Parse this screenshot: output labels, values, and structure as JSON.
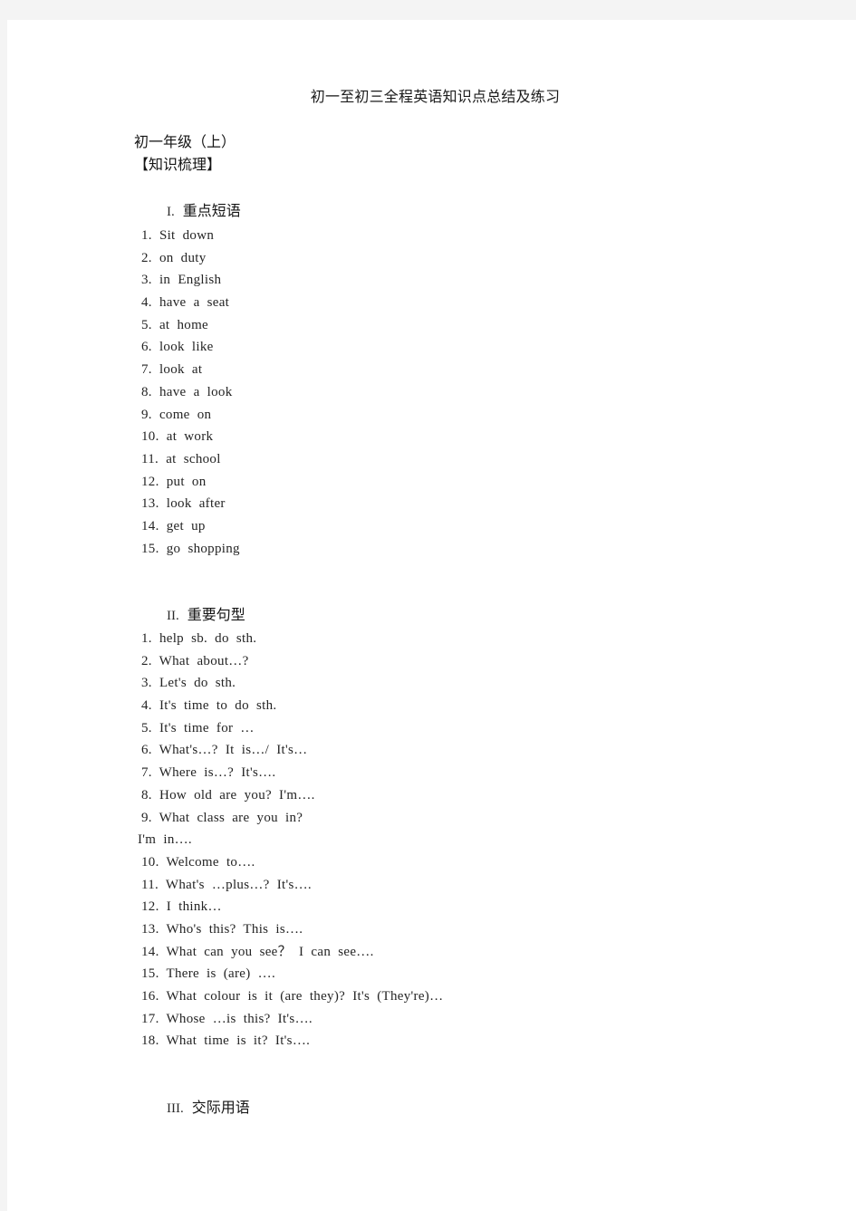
{
  "document": {
    "title": "初一至初三全程英语知识点总结及练习",
    "grade_heading": "初一年级（上）",
    "bracket_heading": "【知识梳理】",
    "sections": [
      {
        "numeral": "I.",
        "label": "重点短语",
        "items": [
          "1.  Sit  down",
          "2.  on  duty",
          "3.  in  English",
          "4.  have  a  seat",
          "5.  at  home",
          "6.  look  like",
          "7.  look  at",
          "8.  have  a  look",
          "9.  come  on",
          "10.  at  work",
          "11.  at  school",
          "12.  put  on",
          "13.  look  after",
          "14.  get  up",
          "15.  go  shopping"
        ]
      },
      {
        "numeral": "II.",
        "label": "重要句型",
        "items": [
          "1.  help  sb.  do  sth.",
          "2.  What  about…?",
          "3.  Let's  do  sth.",
          "4.  It's  time  to  do  sth.",
          "5.  It's  time  for  …",
          "6.  What's…?  It  is…/  It's…",
          "7.  Where  is…?  It's….",
          "8.  How  old  are  you?  I'm….",
          "9.  What  class  are  you  in?",
          "I'm  in….",
          "10.  Welcome  to….",
          "11.  What's  …plus…?  It's….",
          "12.  I  think…",
          "13.  Who's  this?  This  is….",
          "14.  What  can  you  see？  I  can  see….",
          "15.  There  is  (are)  ….",
          "16.  What  colour  is  it  (are  they)?  It's  (They're)…",
          "17.  Whose  …is  this?  It's….",
          "18.  What  time  is  it?  It's…."
        ]
      },
      {
        "numeral": "III.",
        "label": "交际用语",
        "items": []
      }
    ]
  },
  "colors": {
    "page_background": "#ffffff",
    "surround": "#f4f4f4",
    "text": "#242424",
    "heading_text": "#141414"
  }
}
